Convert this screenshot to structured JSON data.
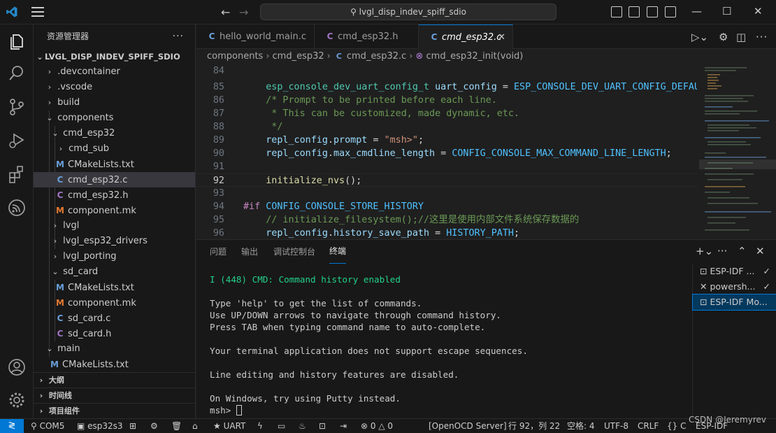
{
  "titlebar": {
    "search_text": "lvgl_disp_indev_spiff_sdio",
    "back_icon": "arrow-left-icon",
    "forward_icon": "arrow-right-icon"
  },
  "sidebar": {
    "header": "资源管理器",
    "more": "···",
    "root": "LVGL_DISP_INDEV_SPIFF_SDIO",
    "items": [
      {
        "label": ".devcontainer"
      },
      {
        "label": ".vscode"
      },
      {
        "label": "build"
      },
      {
        "label": "components"
      },
      {
        "label": "cmd_esp32"
      },
      {
        "label": "cmd_sub"
      },
      {
        "label": "CMakeLists.txt"
      },
      {
        "label": "cmd_esp32.c"
      },
      {
        "label": "cmd_esp32.h"
      },
      {
        "label": "component.mk"
      },
      {
        "label": "lvgl"
      },
      {
        "label": "lvgl_esp32_drivers"
      },
      {
        "label": "lvgl_porting"
      },
      {
        "label": "sd_card"
      },
      {
        "label": "CMakeLists.txt"
      },
      {
        "label": "component.mk"
      },
      {
        "label": "sd_card.c"
      },
      {
        "label": "sd_card.h"
      },
      {
        "label": "main"
      },
      {
        "label": "CMakeLists.txt"
      }
    ],
    "sections": [
      "大纲",
      "时间线",
      "项目组件"
    ]
  },
  "tabs": [
    {
      "label": "hello_world_main.c",
      "icon": "C"
    },
    {
      "label": "cmd_esp32.h",
      "icon": "C"
    },
    {
      "label": "cmd_esp32.c",
      "icon": "C"
    }
  ],
  "breadcrumb": [
    "components",
    "cmd_esp32",
    "cmd_esp32.c",
    "cmd_esp32_init(void)"
  ],
  "code": {
    "line_numbers": [
      "84",
      "85",
      "86",
      "87",
      "88",
      "89",
      "90",
      "91",
      "92",
      "93",
      "94",
      "95",
      "96"
    ],
    "current_line": "92"
  },
  "panel": {
    "tabs": [
      "问题",
      "输出",
      "调试控制台",
      "终端"
    ],
    "terminal_lines": [
      "I (448) CMD: Command history enabled",
      "",
      "Type 'help' to get the list of commands.",
      "Use UP/DOWN arrows to navigate through command history.",
      "Press TAB when typing command name to auto-complete.",
      "",
      "Your terminal application does not support escape sequences.",
      "",
      "Line editing and history features are disabled.",
      "",
      "On Windows, try using Putty instead."
    ],
    "prompt": "msh> ",
    "terminals": [
      {
        "label": "ESP-IDF ...",
        "check": "✓"
      },
      {
        "label": "powersh...",
        "check": "✓"
      },
      {
        "label": "ESP-IDF Mo...",
        "check": ""
      }
    ]
  },
  "statusbar": {
    "port": "COM5",
    "target": "esp32s3",
    "uart": "UART",
    "errors": "0",
    "warnings": "0",
    "openocd": "[OpenOCD Server]",
    "position": "行 92，列 22",
    "spaces": "空格: 4",
    "encoding": "UTF-8",
    "eol": "CRLF",
    "language": "C",
    "idf": "ESP-IDF"
  },
  "watermark": "CSDN @Jeremyrev",
  "colors": {
    "accent": "#0078d4",
    "background": "#1f1f1f",
    "sidebar": "#181818"
  }
}
